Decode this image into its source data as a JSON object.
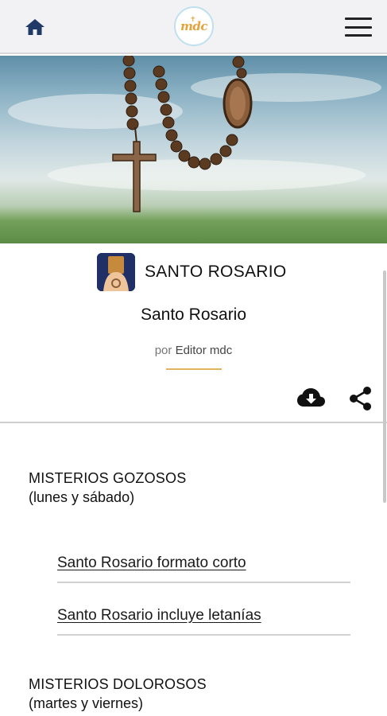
{
  "topbar": {
    "home_icon": "home-icon",
    "logo_text": "mdc",
    "menu_icon": "hamburger-menu-icon"
  },
  "hero": {
    "image": "rosary-against-sky-photo"
  },
  "category": {
    "icon": "praying-hands-rosary-icon",
    "title": "SANTO ROSARIO"
  },
  "post": {
    "title": "Santo Rosario",
    "author_prefix": "por",
    "author_name": "Editor mdc"
  },
  "actions": {
    "download_icon": "cloud-download-icon",
    "share_icon": "share-icon"
  },
  "sections": [
    {
      "title": "MISTERIOS GOZOSOS",
      "days": "(lunes y sábado)",
      "links": [
        "Santo Rosario formato corto",
        "Santo Rosario incluye letanías"
      ]
    },
    {
      "title": "MISTERIOS DOLOROSOS",
      "days": "(martes y viernes)"
    }
  ],
  "colors": {
    "accent_line": "#e4b35c",
    "logo": "#e3a33a",
    "home_icon": "#1f3a66"
  }
}
